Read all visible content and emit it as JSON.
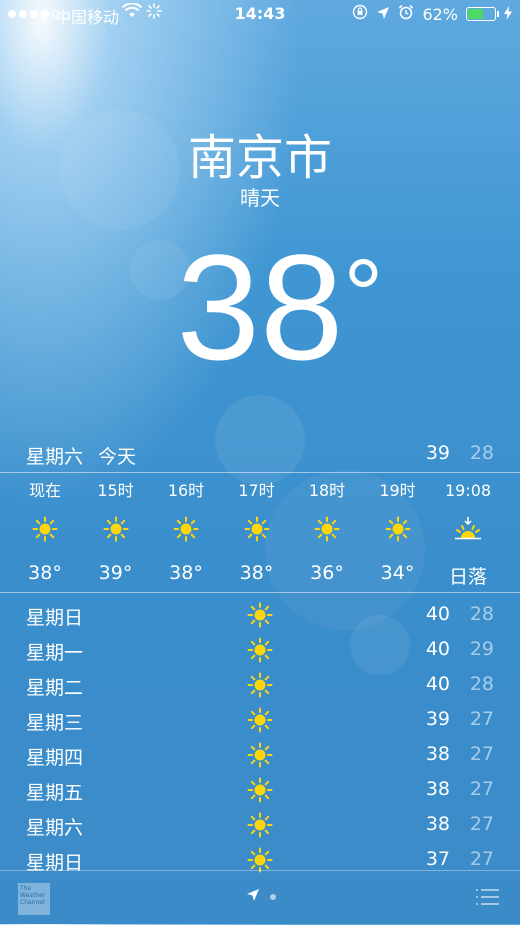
{
  "status_bar": {
    "carrier": "中国移动",
    "time": "14:43",
    "battery": "62%",
    "battery_level": 0.62,
    "battery_color": "#4cd964"
  },
  "location": {
    "city": "南京市",
    "condition": "晴天",
    "temperature": "38",
    "degree_symbol": "°"
  },
  "today": {
    "day": "星期六",
    "label": "今天",
    "high": "39",
    "low": "28"
  },
  "hourly": [
    {
      "time": "现在",
      "icon": "sun-icon",
      "temp": "38°"
    },
    {
      "time": "15时",
      "icon": "sun-icon",
      "temp": "39°"
    },
    {
      "time": "16时",
      "icon": "sun-icon",
      "temp": "38°"
    },
    {
      "time": "17时",
      "icon": "sun-icon",
      "temp": "38°"
    },
    {
      "time": "18时",
      "icon": "sun-icon",
      "temp": "36°"
    },
    {
      "time": "19时",
      "icon": "sun-icon",
      "temp": "34°"
    },
    {
      "time": "19:08",
      "icon": "sunset-icon",
      "temp": "日落"
    }
  ],
  "daily": [
    {
      "day": "星期日",
      "icon": "sun-icon",
      "high": "40",
      "low": "28"
    },
    {
      "day": "星期一",
      "icon": "sun-icon",
      "high": "40",
      "low": "29"
    },
    {
      "day": "星期二",
      "icon": "sun-icon",
      "high": "40",
      "low": "28"
    },
    {
      "day": "星期三",
      "icon": "sun-icon",
      "high": "39",
      "low": "27"
    },
    {
      "day": "星期四",
      "icon": "sun-icon",
      "high": "38",
      "low": "27"
    },
    {
      "day": "星期五",
      "icon": "sun-icon",
      "high": "38",
      "low": "27"
    },
    {
      "day": "星期六",
      "icon": "sun-icon",
      "high": "38",
      "low": "27"
    },
    {
      "day": "星期日",
      "icon": "sun-icon",
      "high": "37",
      "low": "27"
    }
  ],
  "bottom_bar": {
    "brand": "The Weather Channel"
  },
  "colors": {
    "sun": "#ffd60a"
  }
}
